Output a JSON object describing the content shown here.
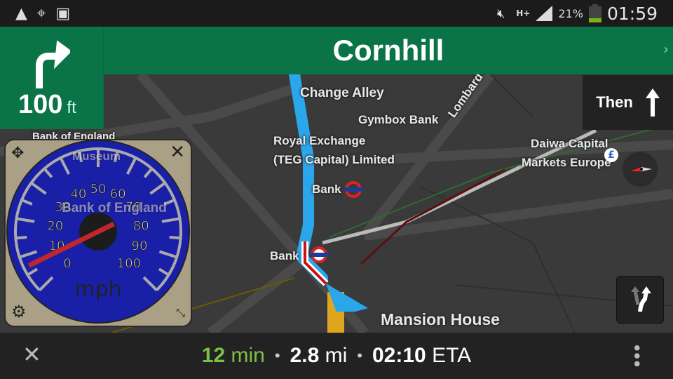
{
  "status_bar": {
    "icons": [
      "navigation-arrow-icon",
      "gps-icon",
      "image-icon",
      "mute-icon",
      "network-hplus-icon",
      "signal-icon",
      "battery-icon"
    ],
    "network": "H+",
    "battery": "21%",
    "time": "01:59"
  },
  "header": {
    "street": "Cornhill",
    "maneuver_icon": "turn-right-icon",
    "distance": "100",
    "distance_unit": "ft"
  },
  "then": {
    "label": "Then",
    "icon": "arrow-up-icon"
  },
  "map": {
    "labels": [
      "Change Alley",
      "Gymbox Bank",
      "Royal Exchange",
      "(TEG Capital) Limited",
      "Bank",
      "Daiwa Capital",
      "Markets Europe",
      "Bank of England",
      "Museum",
      "Bank of England",
      "Bank",
      "Mansion House",
      "Lombard"
    ]
  },
  "speedometer": {
    "unit": "mph",
    "ticks": [
      "0",
      "10",
      "20",
      "30",
      "40",
      "50",
      "60",
      "70",
      "80",
      "90",
      "100"
    ],
    "needle_value": 7,
    "max": 100,
    "face_color": "#1a1fa8",
    "needle_color": "#c0262a"
  },
  "trip": {
    "time": "12",
    "time_unit": "min",
    "distance": "2.8",
    "distance_unit": "mi",
    "eta": "02:10",
    "eta_label": "ETA",
    "time_color": "#7cc242"
  }
}
